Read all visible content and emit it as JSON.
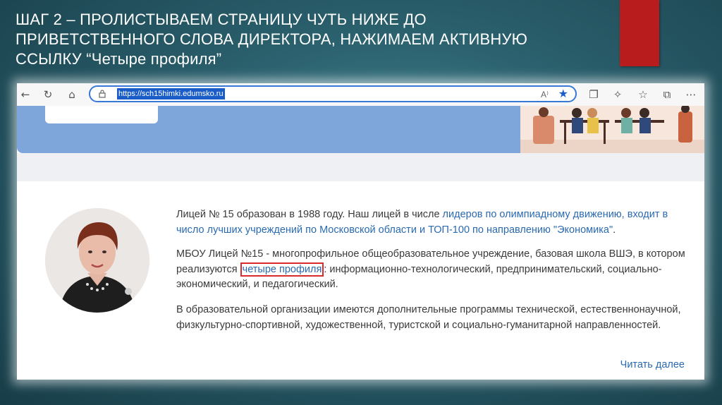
{
  "slide": {
    "title": "ШАГ 2 – ПРОЛИСТЫВАЕМ СТРАНИЦУ ЧУТЬ НИЖЕ ДО ПРИВЕТСТВЕННОГО СЛОВА ДИРЕКТОРА, НАЖИМАЕМ АКТИВНУЮ ССЫЛКУ “Четыре профиля”",
    "accent_color": "#b91c1c"
  },
  "browser": {
    "url": "https://sch15himki.edumsko.ru",
    "read_aloud": "A⁾",
    "icons": [
      "back-arrow-icon",
      "refresh-icon",
      "home-icon",
      "lock-icon",
      "read-aloud-icon",
      "favorite-star-icon",
      "tabs-icon",
      "extensions-icon",
      "favorites-icon",
      "collections-icon"
    ]
  },
  "content": {
    "p1_text": "Лицей № 15 образован в 1988 году. Наш лицей в числе ",
    "p1_link": "лидеров по олимпиадному движению, входит в число лучших учреждений по Московской области и ТОП-100 по направлению \"Экономика\"",
    "p1_end": ".",
    "p2_start": "МБОУ Лицей №15 - многопрофильное общеобразовательное учреждение, базовая школа ВШЭ, в котором реализуются ",
    "p2_link": "четыре профиля",
    "p2_end": ": информационно-технологический, предпринимательский, социально-экономический, и педагогический.",
    "p3": "В образовательной организации имеются дополнительные программы технической, естественнонаучной, физкультурно-спортивной, художественной, туристской и социально-гуманитарной направленностей.",
    "read_more": "Читать далее"
  }
}
